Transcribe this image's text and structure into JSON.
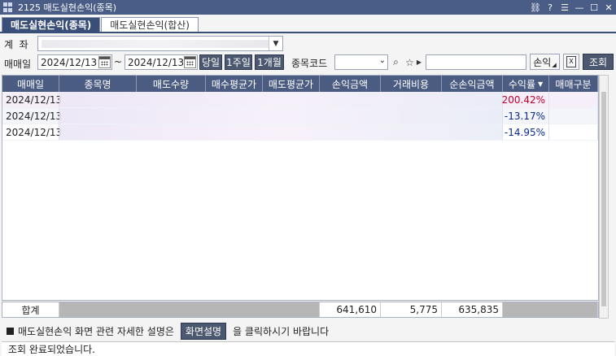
{
  "window": {
    "title": "2125 매도실현손익(종목)"
  },
  "tabs": [
    {
      "label": "매도실현손익(종목)"
    },
    {
      "label": "매도실현손익(합산)"
    }
  ],
  "form": {
    "account_label": "계  좌",
    "trade_date_label": "매매일",
    "date_from": "2024/12/13",
    "range_sep": "~",
    "date_to": "2024/12/13",
    "btn_today": "당일",
    "btn_1week": "1주일",
    "btn_1month": "1개월",
    "code_label": "종목코드",
    "btn_pnl": "손익",
    "btn_query": "조회"
  },
  "table": {
    "headers": [
      "매매일",
      "종목명",
      "매도수량",
      "매수평균가",
      "매도평균가",
      "손익금액",
      "거래비용",
      "순손익금액",
      "수익률",
      "매매구분"
    ],
    "sort_indicator": "▼",
    "rows": [
      {
        "date": "2024/12/13",
        "return": "200.42%"
      },
      {
        "date": "2024/12/13",
        "return": "-13.17%"
      },
      {
        "date": "2024/12/13",
        "return": "-14.95%"
      }
    ],
    "total": {
      "label": "합계",
      "pnl": "641,610",
      "fee": "5,775",
      "net": "635,835"
    }
  },
  "note": {
    "prefix": "매도실현손익 화면 관련 자세한 설명은",
    "button": "화면설명",
    "suffix": "을 클릭하시기 바랍니다"
  },
  "status": "조회 완료되었습니다.",
  "colors": {
    "header_bg": "#4b5c83",
    "positive": "#c0002a",
    "negative": "#0b2a8f"
  }
}
